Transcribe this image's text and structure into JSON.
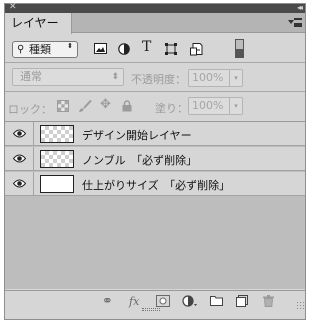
{
  "panel": {
    "tab_label": "レイヤー",
    "close_glyph": "✕",
    "collapse_glyph": "◂◂"
  },
  "filter": {
    "kind_label": "種類",
    "search_glyph": "⚲",
    "updown_glyph": "⬍",
    "icons": [
      "image-filter-icon",
      "adjustment-filter-icon",
      "type-filter-icon",
      "shape-filter-icon",
      "smart-object-filter-icon"
    ],
    "type_icon_glyph": "T"
  },
  "blend": {
    "mode": "通常",
    "opacity_label": "不透明度：",
    "opacity_value": "100%",
    "dropdown_glyph": "▾"
  },
  "lock": {
    "label": "ロック：",
    "fill_label": "塗り：",
    "fill_value": "100%",
    "move_glyph": "✥"
  },
  "layers": [
    {
      "name": "デザイン開始レイヤー",
      "thumbnail": "transparent",
      "visible": true
    },
    {
      "name": "ノンブル　「必ず削除」",
      "thumbnail": "transparent",
      "visible": true
    },
    {
      "name": "仕上がりサイズ　「必ず削除」",
      "thumbnail": "white",
      "visible": true
    }
  ],
  "footer": {
    "link_glyph": "⚭",
    "fx_label": "fx",
    "icons": [
      "link-layers-icon",
      "layer-style-icon",
      "layer-mask-icon",
      "adjustment-layer-icon",
      "group-folder-icon",
      "new-layer-icon",
      "trash-icon"
    ]
  }
}
